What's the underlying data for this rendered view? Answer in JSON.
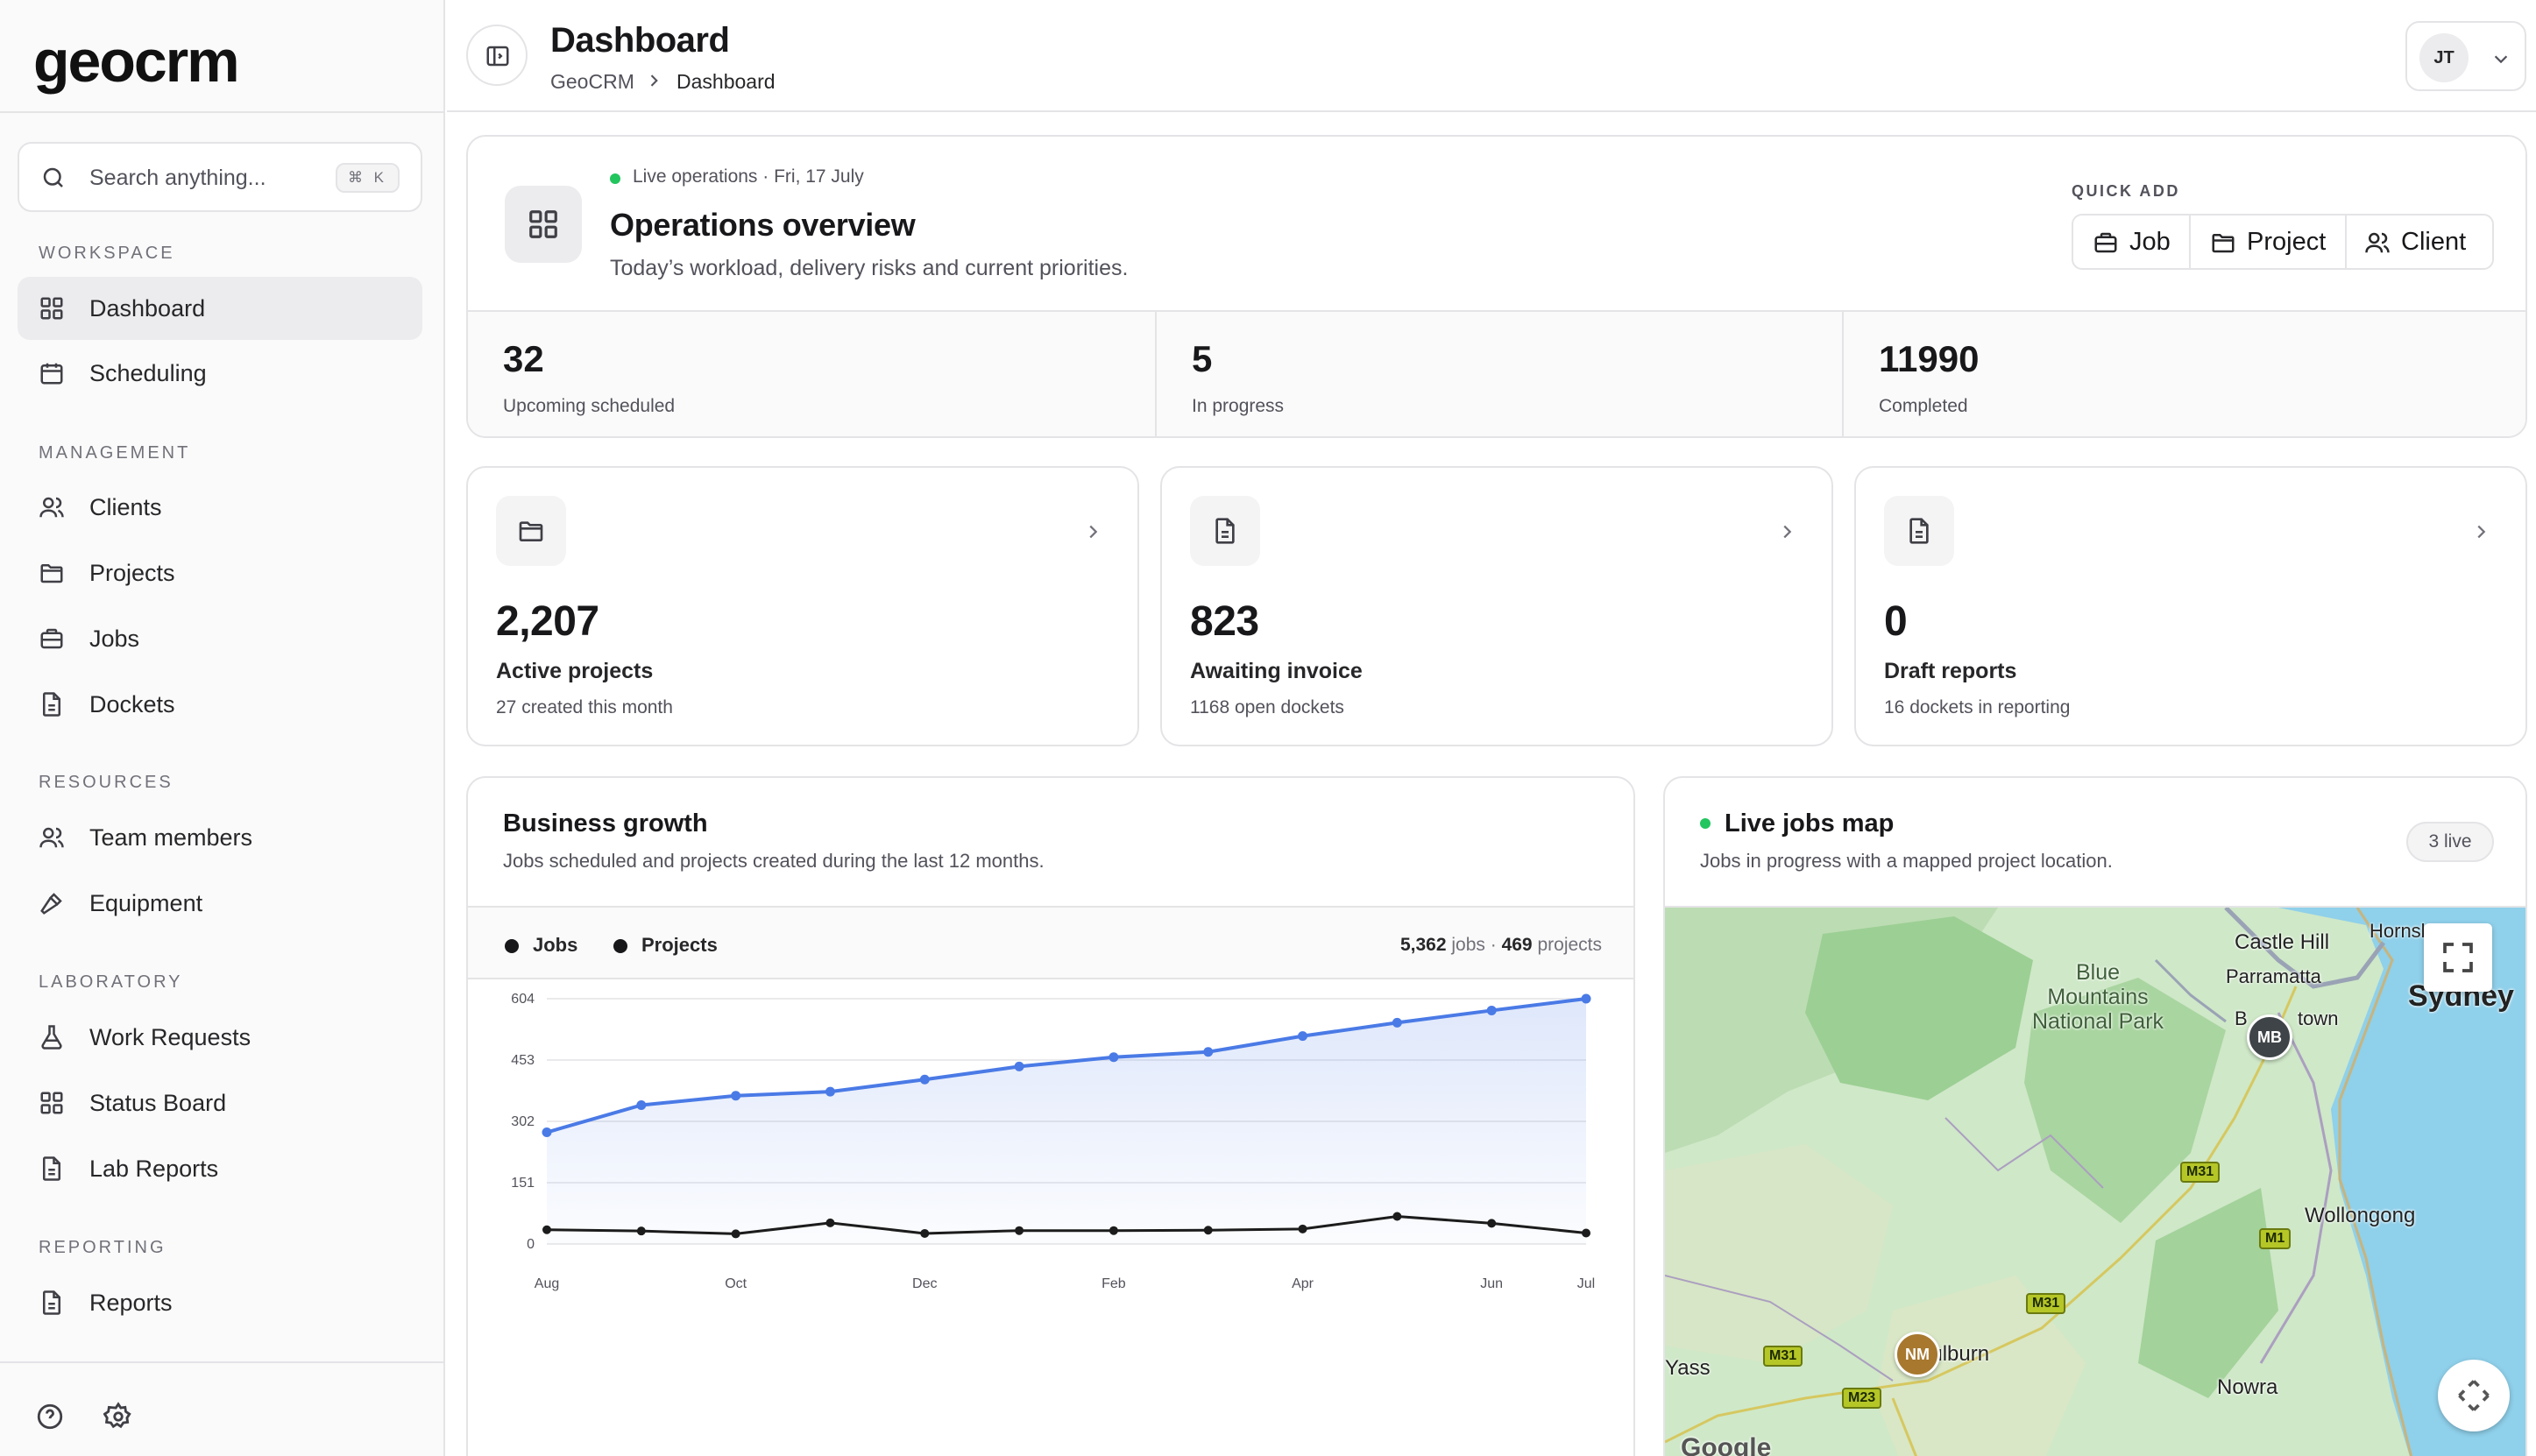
{
  "app": {
    "logo": "geocrm"
  },
  "search": {
    "placeholder": "Search anything...",
    "shortcut": "⌘ K"
  },
  "sidebar": {
    "sections": [
      {
        "label": "Workspace",
        "items": [
          {
            "label": "Dashboard",
            "icon": "grid-icon",
            "active": true
          },
          {
            "label": "Scheduling",
            "icon": "calendar-icon"
          }
        ]
      },
      {
        "label": "Management",
        "items": [
          {
            "label": "Clients",
            "icon": "users-icon"
          },
          {
            "label": "Projects",
            "icon": "folder-icon"
          },
          {
            "label": "Jobs",
            "icon": "briefcase-icon"
          },
          {
            "label": "Dockets",
            "icon": "file-icon"
          }
        ]
      },
      {
        "label": "Resources",
        "items": [
          {
            "label": "Team members",
            "icon": "users-icon"
          },
          {
            "label": "Equipment",
            "icon": "hammer-icon"
          }
        ]
      },
      {
        "label": "Laboratory",
        "items": [
          {
            "label": "Work Requests",
            "icon": "flask-icon"
          },
          {
            "label": "Status Board",
            "icon": "grid-icon"
          },
          {
            "label": "Lab Reports",
            "icon": "file-icon"
          }
        ]
      },
      {
        "label": "Reporting",
        "items": [
          {
            "label": "Reports",
            "icon": "file-icon"
          }
        ]
      }
    ],
    "bottom_icons": [
      "help-icon",
      "settings-icon"
    ]
  },
  "header": {
    "title": "Dashboard",
    "breadcrumb": [
      "GeoCRM",
      "Dashboard"
    ],
    "user_initials": "JT"
  },
  "overview": {
    "live_text": "Live operations · Fri, 17 July",
    "title": "Operations overview",
    "subtitle": "Today’s workload, delivery risks and current priorities.",
    "quick_add_label": "Quick add",
    "quick_add": [
      "Job",
      "Project",
      "Client"
    ],
    "stats": [
      {
        "value": "32",
        "label": "Upcoming scheduled"
      },
      {
        "value": "5",
        "label": "In progress"
      },
      {
        "value": "11990",
        "label": "Completed"
      }
    ]
  },
  "kpis": [
    {
      "value": "2,207",
      "label": "Active projects",
      "sub": "27 created this month",
      "icon": "folder-icon"
    },
    {
      "value": "823",
      "label": "Awaiting invoice",
      "sub": "1168 open dockets",
      "icon": "file-icon"
    },
    {
      "value": "0",
      "label": "Draft reports",
      "sub": "16 dockets in reporting",
      "icon": "file-icon"
    }
  ],
  "growth": {
    "title": "Business growth",
    "subtitle": "Jobs scheduled and projects created during the last 12 months.",
    "legend": [
      "Jobs",
      "Projects"
    ],
    "totals": {
      "jobs_value": "5,362",
      "jobs_label": "jobs",
      "projects_value": "469",
      "projects_label": "projects"
    }
  },
  "chart_data": {
    "type": "line",
    "x": [
      "Aug",
      "Sep",
      "Oct",
      "Nov",
      "Dec",
      "Jan",
      "Feb",
      "Mar",
      "Apr",
      "May",
      "Jun",
      "Jul"
    ],
    "tick_labels_x": [
      "Aug",
      "Oct",
      "Dec",
      "Feb",
      "Apr",
      "Jun",
      "Jul"
    ],
    "yticks": [
      0,
      151,
      302,
      453,
      604
    ],
    "ylim": [
      0,
      604
    ],
    "grid": true,
    "series": [
      {
        "name": "Jobs",
        "color": "#4a7ae6",
        "values": [
          275,
          342,
          365,
          375,
          405,
          437,
          460,
          473,
          512,
          545,
          575,
          604
        ]
      },
      {
        "name": "Projects",
        "color": "#1c1c1c",
        "values": [
          35,
          32,
          25,
          52,
          26,
          33,
          33,
          34,
          37,
          68,
          51,
          27
        ]
      }
    ]
  },
  "map": {
    "title": "Live jobs map",
    "subtitle": "Jobs in progress with a mapped project location.",
    "badge": "3 live",
    "places": [
      "Castle Hill",
      "Hornsb",
      "Parramatta",
      "Sydney",
      "Blue Mountains National Park",
      "B",
      "town",
      "Wollongong",
      "oulburn",
      "Yass",
      "Nowra",
      "Google"
    ],
    "roads": [
      "M31",
      "M1",
      "M31",
      "M31",
      "M23"
    ],
    "markers": [
      {
        "initials": "MB",
        "color": "#3f4448"
      },
      {
        "initials": "NM",
        "color": "#a7782e"
      }
    ]
  }
}
